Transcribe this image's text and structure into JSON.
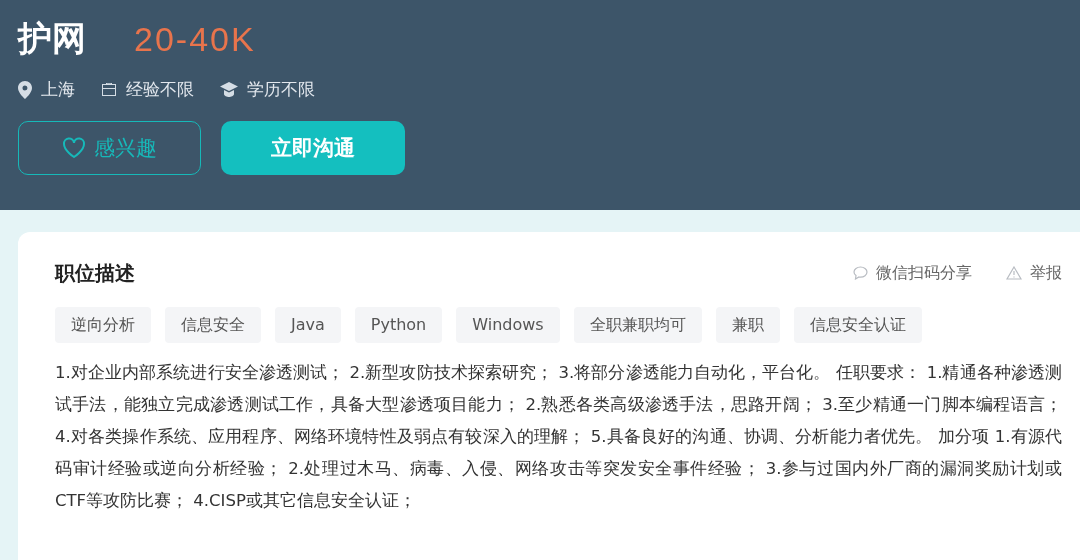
{
  "job": {
    "title": "护网",
    "salary": "20-40K",
    "meta": [
      {
        "kind": "location",
        "text": "上海"
      },
      {
        "kind": "experience",
        "text": "经验不限"
      },
      {
        "kind": "education",
        "text": "学历不限"
      }
    ]
  },
  "actions": {
    "interest": "感兴趣",
    "chat": "立即沟通"
  },
  "description": {
    "heading": "职位描述",
    "share": "微信扫码分享",
    "report": "举报",
    "tags": [
      "逆向分析",
      "信息安全",
      "Java",
      "Python",
      "Windows",
      "全职兼职均可",
      "兼职",
      "信息安全认证"
    ],
    "text": "1.对企业内部系统进行安全渗透测试； 2.新型攻防技术探索研究； 3.将部分渗透能力自动化，平台化。 任职要求： 1.精通各种渗透测试手法，能独立完成渗透测试工作，具备大型渗透项目能力； 2.熟悉各类高级渗透手法，思路开阔； 3.至少精通一门脚本编程语言； 4.对各类操作系统、应用程序、网络环境特性及弱点有较深入的理解； 5.具备良好的沟通、协调、分析能力者优先。 加分项 1.有源代码审计经验或逆向分析经验； 2.处理过木马、病毒、入侵、网络攻击等突发安全事件经验； 3.参与过国内外厂商的漏洞奖励计划或CTF等攻防比赛； 4.CISP或其它信息安全认证；"
  }
}
